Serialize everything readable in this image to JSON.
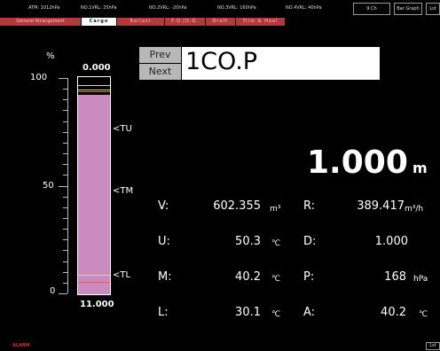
{
  "status": {
    "atm": "ATM: 1012hPa",
    "vrl1": "NO.1VRL: 25hPa",
    "vrl2": "NO.2VRL: -20hPa",
    "vrl3": "NO.3VRL: 160hPa",
    "vrl4": "NO.4VRL: 40hPa",
    "btn1": "9 Ch",
    "btn2": "Bar Graph",
    "btn3": "Lst"
  },
  "tabs": [
    "General Arrangement",
    "Cargo",
    "Ballast",
    "F.O./D.O.",
    "Draft",
    "Trim & Heel"
  ],
  "gauge": {
    "unit": "%",
    "top_value": "0.000",
    "bottom_value": "11.000",
    "fill_fraction": 0.92,
    "scale_labels": [
      "100",
      "50",
      "0"
    ],
    "markers": [
      "<TU",
      "<TM",
      "<TL"
    ],
    "fill_color": "#c98bc0"
  },
  "tank": {
    "prev_label": "Prev",
    "next_label": "Next",
    "name": "1CO.P",
    "level_value": "1.000",
    "level_unit": "m"
  },
  "readings": {
    "v_label": "V:",
    "v_value": "602.355",
    "v_unit": "m³",
    "u_label": "U:",
    "u_value": "50.3",
    "u_unit": "℃",
    "m_label": "M:",
    "m_value": "40.2",
    "m_unit": "℃",
    "l_label": "L:",
    "l_value": "30.1",
    "l_unit": "℃",
    "r_label": "R:",
    "r_value": "389.417",
    "r_unit": "m³/h",
    "d_label": "D:",
    "d_value": "1.000",
    "p_label": "P:",
    "p_value": "168",
    "p_unit": "hPa",
    "a_label": "A:",
    "a_value": "40.2",
    "a_unit": "℃"
  },
  "footer": {
    "alarm": "ALARM",
    "corner": "Lst"
  }
}
